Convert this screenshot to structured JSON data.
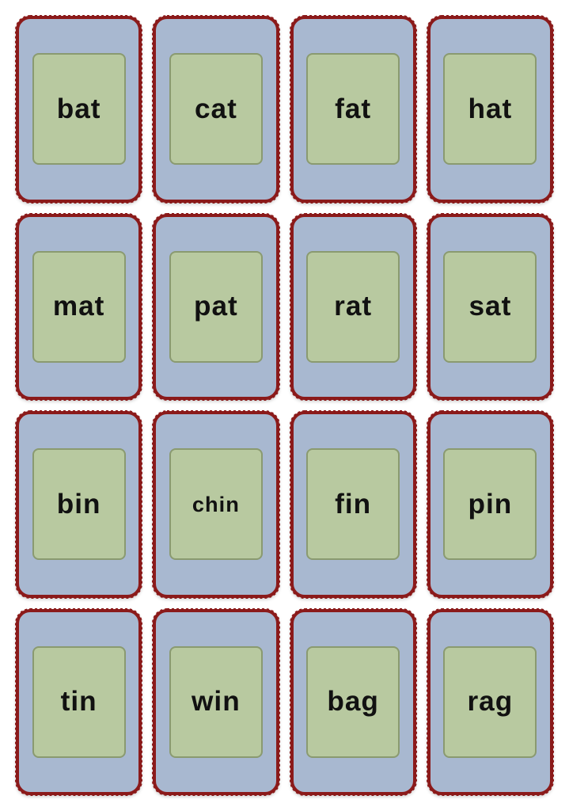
{
  "cards": [
    {
      "word": "bat",
      "small": false
    },
    {
      "word": "cat",
      "small": false
    },
    {
      "word": "fat",
      "small": false
    },
    {
      "word": "hat",
      "small": false
    },
    {
      "word": "mat",
      "small": false
    },
    {
      "word": "pat",
      "small": false
    },
    {
      "word": "rat",
      "small": false
    },
    {
      "word": "sat",
      "small": false
    },
    {
      "word": "bin",
      "small": false
    },
    {
      "word": "chin",
      "small": true
    },
    {
      "word": "fin",
      "small": false
    },
    {
      "word": "pin",
      "small": false
    },
    {
      "word": "tin",
      "small": false
    },
    {
      "word": "win",
      "small": false
    },
    {
      "word": "bag",
      "small": false
    },
    {
      "word": "rag",
      "small": false
    }
  ]
}
